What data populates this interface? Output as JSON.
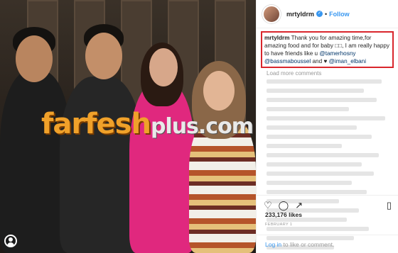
{
  "header": {
    "username": "mrtyldrm",
    "follow_label": "Follow",
    "separator": "•"
  },
  "caption": {
    "username": "mrtyldrm",
    "text_1": "Thank you for amazing time,for amazing food and for baby",
    "emoji_placeholder": "□□",
    "text_2": ", I am really happy to have friends like u",
    "mention_1": "@tamerhosny",
    "mention_2": "@bassmaboussel",
    "text_3": "and",
    "heart": "♥",
    "mention_3": "@iman_elbani"
  },
  "load_more_label": "Load more comments",
  "likes": "233,176 likes",
  "date": "FEBRUARY 1",
  "footer": {
    "login_label": "Log in",
    "rest": "to like or comment."
  },
  "watermark": {
    "part_a": "farfesh",
    "part_b": "plus.com"
  },
  "icons": [
    "verified-badge-icon",
    "heart-icon",
    "comment-icon",
    "share-icon",
    "bookmark-icon",
    "user-tag-icon"
  ],
  "colors": {
    "follow": "#3897f0",
    "highlight_border": "#d9262c",
    "mention": "#003569"
  }
}
